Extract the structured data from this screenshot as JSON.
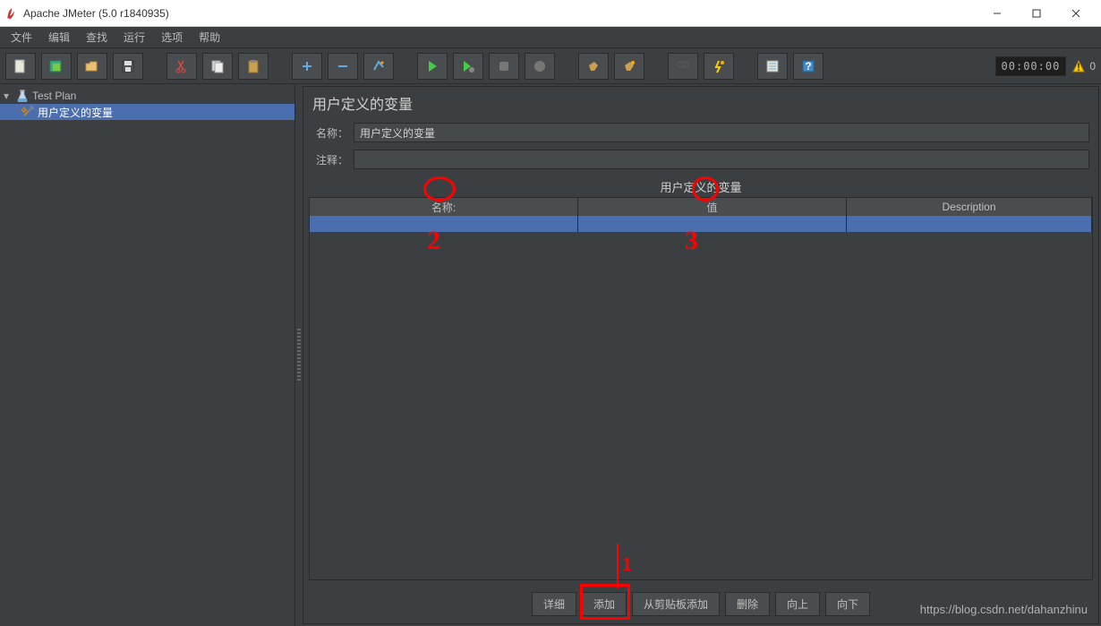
{
  "window": {
    "title": "Apache JMeter (5.0 r1840935)"
  },
  "menu": {
    "file": "文件",
    "edit": "编辑",
    "search": "查找",
    "run": "运行",
    "options": "选项",
    "help": "帮助"
  },
  "status": {
    "time": "00:00:00",
    "warn_count": "0"
  },
  "tree": {
    "root": "Test Plan",
    "node1": "用户定义的变量"
  },
  "panel": {
    "title": "用户定义的变量",
    "name_label": "名称：",
    "name_value": "用户定义的变量",
    "comment_label": "注释：",
    "comment_value": "",
    "section_title": "用户定义的变量"
  },
  "table": {
    "col1": "名称:",
    "col2": "值",
    "col3": "Description"
  },
  "buttons": {
    "detail": "详细",
    "add": "添加",
    "from_clip": "从剪贴板添加",
    "delete": "删除",
    "up": "向上",
    "down": "向下"
  },
  "watermark": "https://blog.csdn.net/dahanzhinu",
  "anno": {
    "n2": "2",
    "n3": "3",
    "n1": "1"
  }
}
